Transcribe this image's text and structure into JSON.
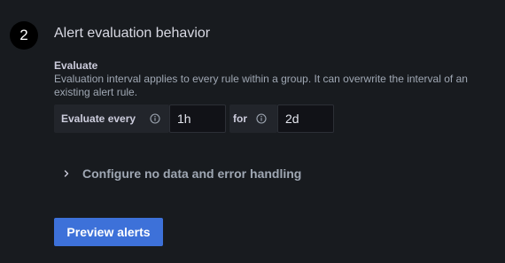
{
  "section": {
    "step_number": "2",
    "title": "Alert evaluation behavior"
  },
  "evaluate": {
    "label": "Evaluate",
    "description": "Evaluation interval applies to every rule within a group. It can overwrite the interval of an existing alert rule.",
    "every_label": "Evaluate every",
    "interval_value": "1h",
    "for_label": "for",
    "pending_value": "2d"
  },
  "config": {
    "toggle_label": "Configure no data and error handling"
  },
  "actions": {
    "preview_label": "Preview alerts"
  },
  "icons": {
    "info": "info-circle-icon",
    "chevron": "chevron-right-icon"
  },
  "colors": {
    "background": "#181b1f",
    "primary_button": "#3d71d9",
    "label_box": "#22252b",
    "input_bg": "#111217"
  }
}
